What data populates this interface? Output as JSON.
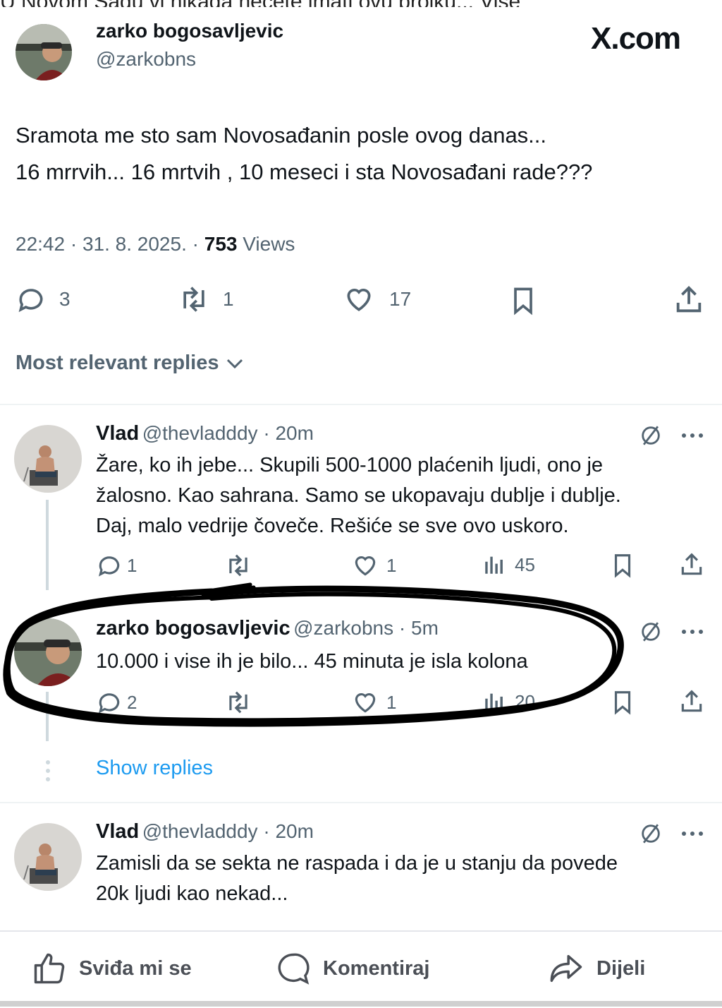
{
  "top_cut_text": "U Novom Sadu vi nikada necete imati ovu brojku... Vise",
  "tweet": {
    "author_name": "zarko bogosavljevic",
    "author_handle": "@zarkobns",
    "site_logo": "X.com",
    "text_line1": "Sramota me sto sam Novosađanin posle ovog danas...",
    "text_line2": "16 mrrvih... 16 mrtvih , 10 meseci i sta Novosađani rade???",
    "time": "22:42 · 31. 8. 2025. ·",
    "views_count": "753",
    "views_label": "Views",
    "replies": "3",
    "reposts": "1",
    "likes": "17"
  },
  "section_title": "Most relevant replies",
  "replies": [
    {
      "name": "Vlad",
      "handle": "@thevladddy · 20m",
      "line1": "Žare, ko ih jebe... Skupili 500-1000 plaćenih ljudi, ono je",
      "line2": "žalosno. Kao sahrana. Samo se ukopavaju dublje i dublje.",
      "line3": "Daj, malo vedrije čoveče. Rešiće se sve ovo uskoro.",
      "comments": "1",
      "likes": "1",
      "views": "45"
    },
    {
      "name": "zarko bogosavljevic",
      "handle": "@zarkobns · 5m",
      "line1": "10.000 i vise ih je bilo... 45 minuta je isla kolona",
      "comments": "2",
      "likes": "1",
      "views": "20"
    },
    {
      "name": "Vlad",
      "handle": "@thevladddy · 20m",
      "line1": "Zamisli da se sekta ne raspada i da je u stanju da povede",
      "line2": "20k ljudi kao nekad..."
    }
  ],
  "show_replies": "Show replies",
  "facebook_bar": {
    "like": "Sviđa mi se",
    "comment": "Komentiraj",
    "share": "Dijeli"
  },
  "colors": {
    "link": "#1d9bf0",
    "secondary_text": "#536471",
    "primary_text": "#0f1419",
    "divider": "#eff3f4"
  },
  "icons": [
    "reply-icon",
    "repost-icon",
    "like-icon",
    "bookmark-icon",
    "share-icon",
    "views-icon",
    "grok-icon",
    "more-icon",
    "thumbs-up-icon",
    "comment-bubble-icon",
    "share-arrow-icon",
    "chevron-down-icon"
  ]
}
